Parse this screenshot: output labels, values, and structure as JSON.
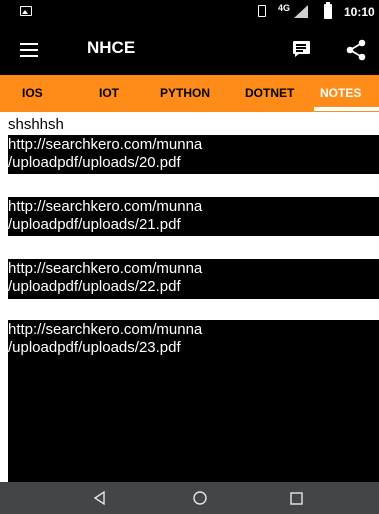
{
  "status_bar": {
    "network": "4G",
    "time": "10:10"
  },
  "app_bar": {
    "title": "NHCE",
    "icons": [
      "menu-icon",
      "chat-icon",
      "share-icon"
    ]
  },
  "tabs": [
    {
      "label": "IOS",
      "active": false
    },
    {
      "label": "IOT",
      "active": false
    },
    {
      "label": "PYTHON",
      "active": false
    },
    {
      "label": "DOTNET",
      "active": false
    },
    {
      "label": "NOTES",
      "active": true
    }
  ],
  "content": {
    "note_title": "shshhsh",
    "links": [
      {
        "line1": "http://searchkero.com/munna",
        "line2": "/uploadpdf/uploads/20.pdf"
      },
      {
        "line1": "http://searchkero.com/munna",
        "line2": "/uploadpdf/uploads/21.pdf"
      },
      {
        "line1": "http://searchkero.com/munna",
        "line2": "/uploadpdf/uploads/22.pdf"
      },
      {
        "line1": "http://searchkero.com/munna",
        "line2": "/uploadpdf/uploads/23.pdf"
      }
    ]
  },
  "nav_bar": {
    "icons": [
      "back-icon",
      "home-icon",
      "recents-icon"
    ]
  },
  "colors": {
    "tab_bar": "#ff8c19",
    "app_bar": "#000000",
    "nav_bar": "#434546",
    "link_background": "#000000",
    "link_text": "#ffffff"
  }
}
